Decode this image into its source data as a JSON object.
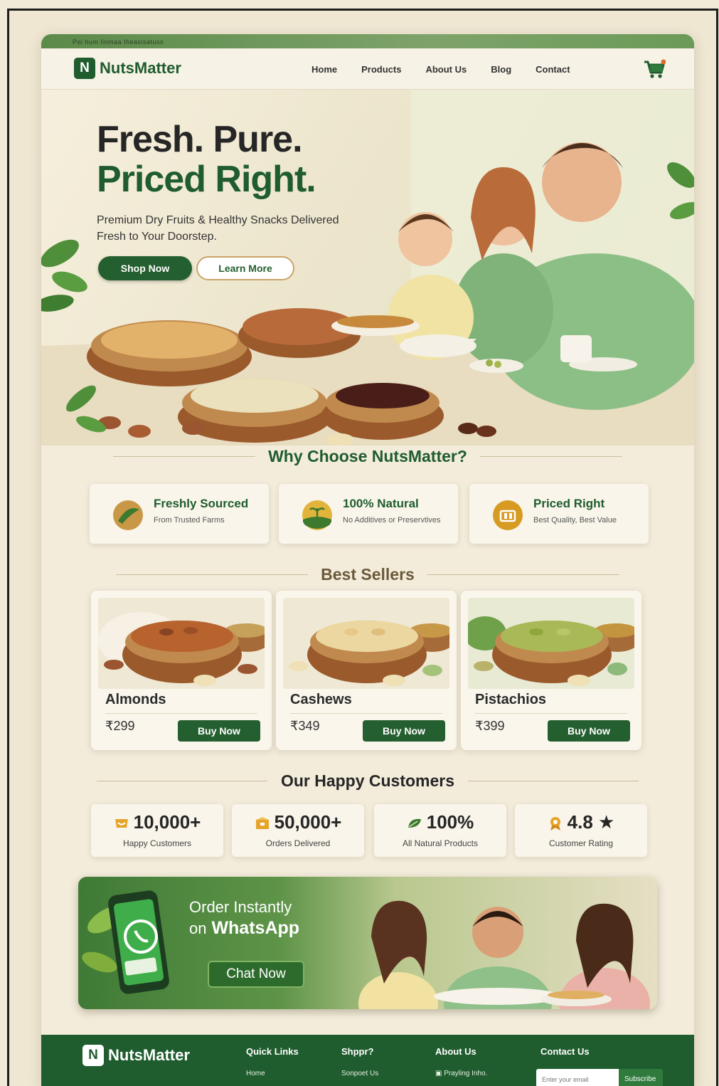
{
  "topstrip": {
    "text": "Poi hum linmaa Iheasisatuss"
  },
  "brand": {
    "name": "NutsMatter",
    "badge": "N"
  },
  "nav": {
    "links": [
      "Home",
      "Products",
      "About Us",
      "Blog",
      "Contact"
    ],
    "cart_icon": "cart-icon"
  },
  "hero": {
    "title_line1": "Fresh. Pure.",
    "title_line2": "Priced Right.",
    "subtitle": "Premium Dry Fruits & Healthy Snacks Delivered Fresh to Your Doorstep.",
    "primary_button": "Shop Now",
    "secondary_button": "Learn More"
  },
  "why": {
    "title": "Why Choose NutsMatter?",
    "features": [
      {
        "title": "Freshly Sourced",
        "subtitle": "From Trusted Farms",
        "icon": "leaf-icon"
      },
      {
        "title": "100% Natural",
        "subtitle": "No Additives or Preservtives",
        "icon": "natural-icon"
      },
      {
        "title": "Priced Right",
        "subtitle": "Best Quality, Best Value",
        "icon": "price-tag-icon"
      }
    ]
  },
  "bestsellers": {
    "title": "Best Sellers",
    "products": [
      {
        "name": "Almonds",
        "price": "₹299",
        "button": "Buy Now"
      },
      {
        "name": "Cashews",
        "price": "₹349",
        "button": "Buy Now"
      },
      {
        "name": "Pistachios",
        "price": "₹399",
        "button": "Buy Now"
      }
    ]
  },
  "customers": {
    "title": "Our Happy Customers",
    "stats": [
      {
        "value": "10,000+",
        "label": "Happy Customers",
        "icon": "smile-icon"
      },
      {
        "value": "50,000+",
        "label": "Orders Delivered",
        "icon": "box-icon"
      },
      {
        "value": "100%",
        "label": "All Natural Products",
        "icon": "leaf-icon"
      },
      {
        "value": "4.8 ★",
        "label": "Customer Rating",
        "icon": "award-icon"
      }
    ]
  },
  "whatsapp": {
    "line1": "Order Instantly",
    "line2_prefix": "on",
    "line2_brand": "WhatsApp",
    "button": "Chat Now"
  },
  "footer": {
    "brand": "NutsMatter",
    "columns": [
      {
        "heading": "Quick Links",
        "item": "Home"
      },
      {
        "heading": "Shppr?",
        "item": "Sonpoet Us"
      },
      {
        "heading": "About Us",
        "item": "Prayling Inho."
      },
      {
        "heading": "Contact Us",
        "item": ""
      }
    ],
    "subscribe_placeholder": "Enter your email",
    "subscribe_button": "Subscribe"
  },
  "colors": {
    "brand_green": "#1f5c2e",
    "button_green": "#245f2f",
    "background": "#f3ecdb"
  }
}
